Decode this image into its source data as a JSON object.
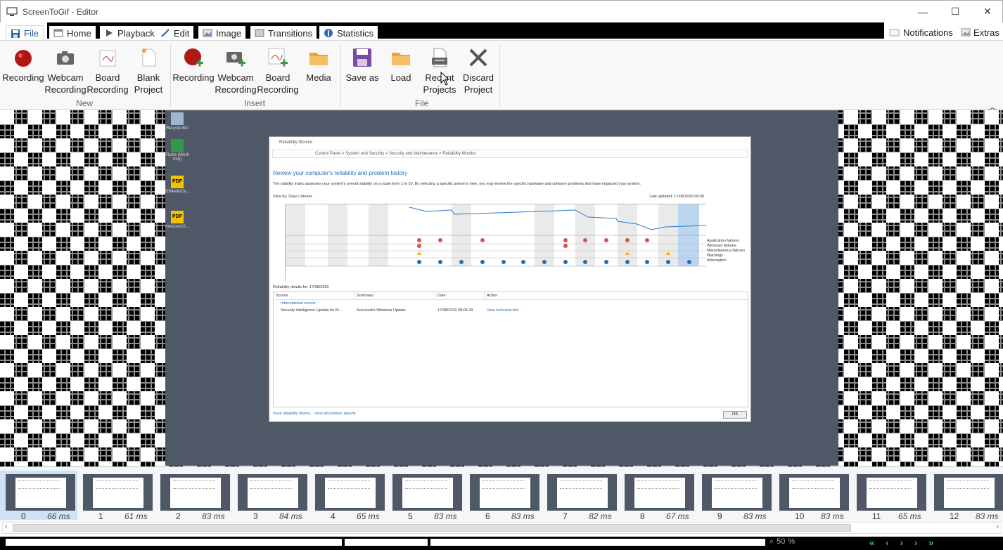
{
  "window": {
    "title": "ScreenToGif - Editor",
    "minimize": "—",
    "maximize": "☐",
    "close": "✕"
  },
  "tabs": [
    {
      "label": "File",
      "icon": "save-icon",
      "active": true
    },
    {
      "label": "Home",
      "icon": "home-icon"
    },
    {
      "label": "Playback",
      "icon": "play-icon"
    },
    {
      "label": "Edit",
      "icon": "pen-icon"
    },
    {
      "label": "Image",
      "icon": "image-icon"
    },
    {
      "label": "Transitions",
      "icon": "transitions-icon"
    },
    {
      "label": "Statistics",
      "icon": "info-icon"
    }
  ],
  "right_links": {
    "notifications": "Notifications",
    "extras": "Extras"
  },
  "ribbon": {
    "new_group": "New",
    "insert_group": "Insert",
    "file_group": "File",
    "new": [
      {
        "label": "Recording",
        "icon": "recording-icon"
      },
      {
        "label": "Webcam\nRecording",
        "icon": "webcam-icon"
      },
      {
        "label": "Board\nRecording",
        "icon": "board-icon"
      },
      {
        "label": "Blank\nProject",
        "icon": "blank-project-icon"
      }
    ],
    "insert": [
      {
        "label": "Recording",
        "icon": "insert-recording-icon"
      },
      {
        "label": "Webcam\nRecording",
        "icon": "insert-webcam-icon"
      },
      {
        "label": "Board\nRecording",
        "icon": "insert-board-icon"
      },
      {
        "label": "Media",
        "icon": "media-folder-icon"
      }
    ],
    "file": [
      {
        "label": "Save as",
        "icon": "save-as-icon"
      },
      {
        "label": "Load",
        "icon": "load-folder-icon"
      },
      {
        "label": "Recent\nProjects",
        "icon": "recent-projects-icon"
      },
      {
        "label": "Discard\nProject",
        "icon": "discard-icon"
      }
    ]
  },
  "preview": {
    "rm_title": "Reliability Monitor",
    "rm_address": "Control Panel  >  System and Security  >  Security and Maintenance  >  Reliability Monitor",
    "rm_heading": "Review your computer's reliability and problem history",
    "rm_desc": "The stability index assesses your system's overall stability on a scale from 1 to 10. By selecting a specific period in time, you may review the specific hardware and software problems that have impacted your system.",
    "rm_viewby": "View by: Days | Weeks",
    "rm_updated": "Last updated: 17/08/2020 08:00",
    "rm_legend": [
      "Application failures",
      "Windows failures",
      "Miscellaneous failures",
      "Warnings",
      "Information"
    ],
    "rm_details": "Reliability details for: 17/08/2020",
    "rm_columns": [
      "Source",
      "Summary",
      "Date",
      "Action"
    ],
    "rm_group": "Informational events",
    "rm_row": [
      "Security Intelligence Update for M...",
      "Successful Windows Update",
      "17/08/2020 08:04:29",
      "View technical det..."
    ],
    "rm_footer": "Save reliability history...     View all problem reports",
    "rm_ok": "OK",
    "desktop_icons": [
      "Recycle Bin",
      "Flyzie (Work Imp)",
      "DWeeksDu...",
      "Invoices10..."
    ]
  },
  "frames": [
    {
      "num": "0",
      "ms": "66 ms",
      "selected": true
    },
    {
      "num": "1",
      "ms": "61 ms"
    },
    {
      "num": "2",
      "ms": "83 ms"
    },
    {
      "num": "3",
      "ms": "84 ms"
    },
    {
      "num": "4",
      "ms": "65 ms"
    },
    {
      "num": "5",
      "ms": "83 ms"
    },
    {
      "num": "6",
      "ms": "83 ms"
    },
    {
      "num": "7",
      "ms": "82 ms"
    },
    {
      "num": "8",
      "ms": "67 ms"
    },
    {
      "num": "9",
      "ms": "83 ms"
    },
    {
      "num": "10",
      "ms": "83 ms"
    },
    {
      "num": "11",
      "ms": "65 ms"
    },
    {
      "num": "12",
      "ms": "83 ms"
    }
  ],
  "status": {
    "zoom": "50",
    "percent": "%"
  },
  "colors": {
    "accent": "#1a56a8",
    "nav_green": "#3cb88a",
    "desktop": "#4f5866"
  }
}
